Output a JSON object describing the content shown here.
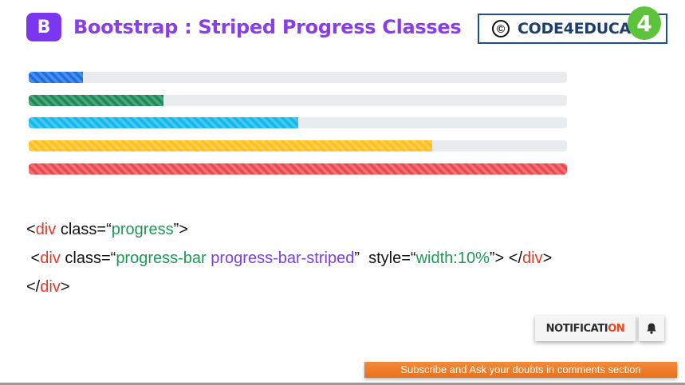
{
  "header": {
    "logo_letter": "B",
    "title": "Bootstrap : Striped Progress Classes",
    "brand_copyright": "©",
    "brand_text": "CODE4EDUCAT",
    "brand_badge": "4"
  },
  "progress_bars": [
    {
      "name": "primary",
      "percent": 10,
      "color": "#1a6fe6"
    },
    {
      "name": "success",
      "percent": 25,
      "color": "#1e8a57"
    },
    {
      "name": "info",
      "percent": 50,
      "color": "#14b9eb"
    },
    {
      "name": "warning",
      "percent": 75,
      "color": "#ffc01a"
    },
    {
      "name": "danger",
      "percent": 100,
      "color": "#ea4a4f"
    }
  ],
  "code": {
    "line1": {
      "lt": "<",
      "tag": "div",
      "attr": " class=",
      "open_quote": "“",
      "value": "progress",
      "close_quote": "”",
      "gt": ">"
    },
    "line2": {
      "lt": " <",
      "tag": "div",
      "attr": " class=",
      "open_quote": "“",
      "value1": "progress-bar",
      "value2": " progress-bar-striped",
      "close_quote": "”",
      "style_attr": "  style=",
      "style_open_quote": "“",
      "style_value": "width:10%",
      "style_close_quote": "”",
      "gt_close": "> </",
      "close_tag": "div",
      "end": ">"
    },
    "line3": {
      "lt": "</",
      "tag": "div",
      "gt": ">"
    }
  },
  "notification": {
    "label_prefix": "NOTIFICATI",
    "label_suffix": "ON",
    "bell_icon": "bell-icon"
  },
  "subscribe": {
    "text": "Subscribe and Ask your doubts in comments section"
  }
}
